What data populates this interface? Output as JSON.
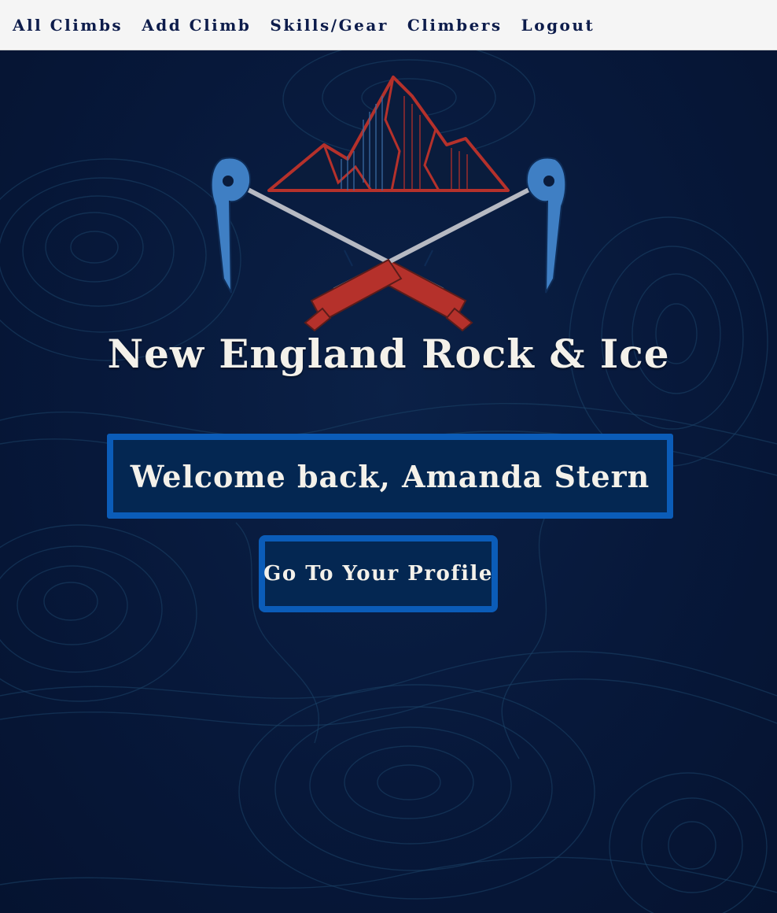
{
  "nav": {
    "items": [
      {
        "label": "All Climbs"
      },
      {
        "label": "Add Climb"
      },
      {
        "label": "Skills/Gear"
      },
      {
        "label": "Climbers"
      },
      {
        "label": "Logout"
      }
    ]
  },
  "hero": {
    "title": "New England Rock & Ice",
    "welcome": "Welcome back, Amanda Stern",
    "profile_button_label": "Go To Your Profile",
    "logo_icon": "mountain-crossed-ice-axes-icon"
  },
  "colors": {
    "background": "#061634",
    "navbar": "#f5f5f5",
    "nav_text": "#0d1c4b",
    "accent_border": "#0b5cb8",
    "box_fill": "#042752",
    "logo_red": "#b5312b",
    "logo_blue": "#3f7fc4",
    "title_text": "#f4f1ea"
  }
}
